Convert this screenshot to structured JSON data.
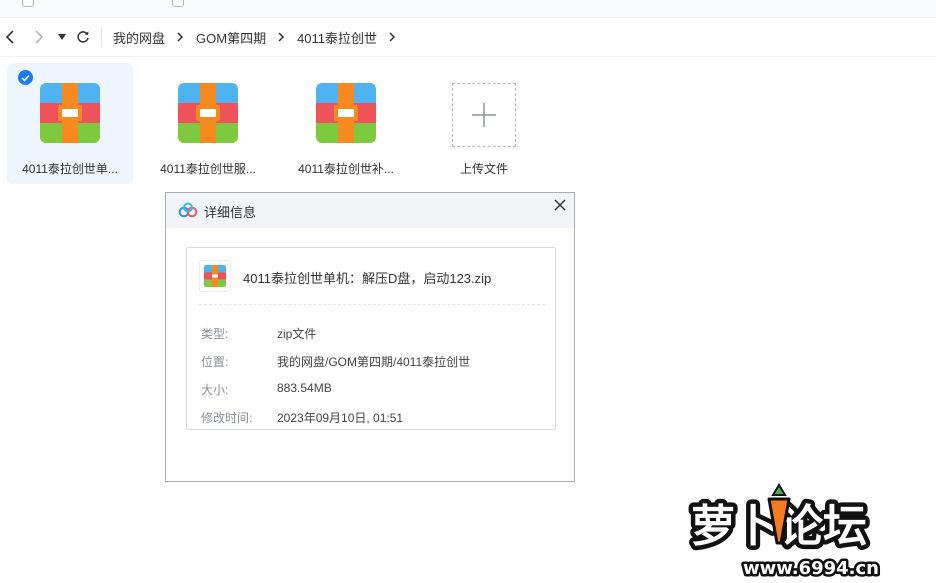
{
  "nav": {
    "back_icon": "chevron-left-icon",
    "forward_icon": "chevron-right-icon",
    "dropdown_icon": "caret-down-icon",
    "refresh_icon": "refresh-icon"
  },
  "breadcrumb": [
    "我的网盘",
    "GOM第四期",
    "4011泰拉创世"
  ],
  "files": [
    {
      "name": "4011泰拉创世单...",
      "icon": "archive-icon",
      "selected": true
    },
    {
      "name": "4011泰拉创世服...",
      "icon": "archive-icon",
      "selected": false
    },
    {
      "name": "4011泰拉创世补...",
      "icon": "archive-icon",
      "selected": false
    }
  ],
  "upload": {
    "label": "上传文件",
    "icon": "plus-icon"
  },
  "dialog": {
    "title": "详细信息",
    "logo_icon": "cloud-logo-icon",
    "close_icon": "close-icon",
    "filename": "4011泰拉创世单机：解压D盘，启动123.zip",
    "rows": [
      {
        "label": "类型:",
        "value": "zip文件"
      },
      {
        "label": "位置:",
        "value": "我的网盘/GOM第四期/4011泰拉创世"
      },
      {
        "label": "大小:",
        "value": "883.54MB"
      },
      {
        "label": "修改时间:",
        "value": "2023年09月10日, 01:51"
      }
    ]
  },
  "watermark": {
    "text": "萝卜论坛",
    "url": "www.6994.cn"
  },
  "colors": {
    "accent": "#1a7bf5",
    "selected_bg": "#eef5ff",
    "archive_blue": "#4fb3f2",
    "archive_red": "#f0525a",
    "archive_green": "#7dc940",
    "archive_orange": "#f68a1f"
  }
}
